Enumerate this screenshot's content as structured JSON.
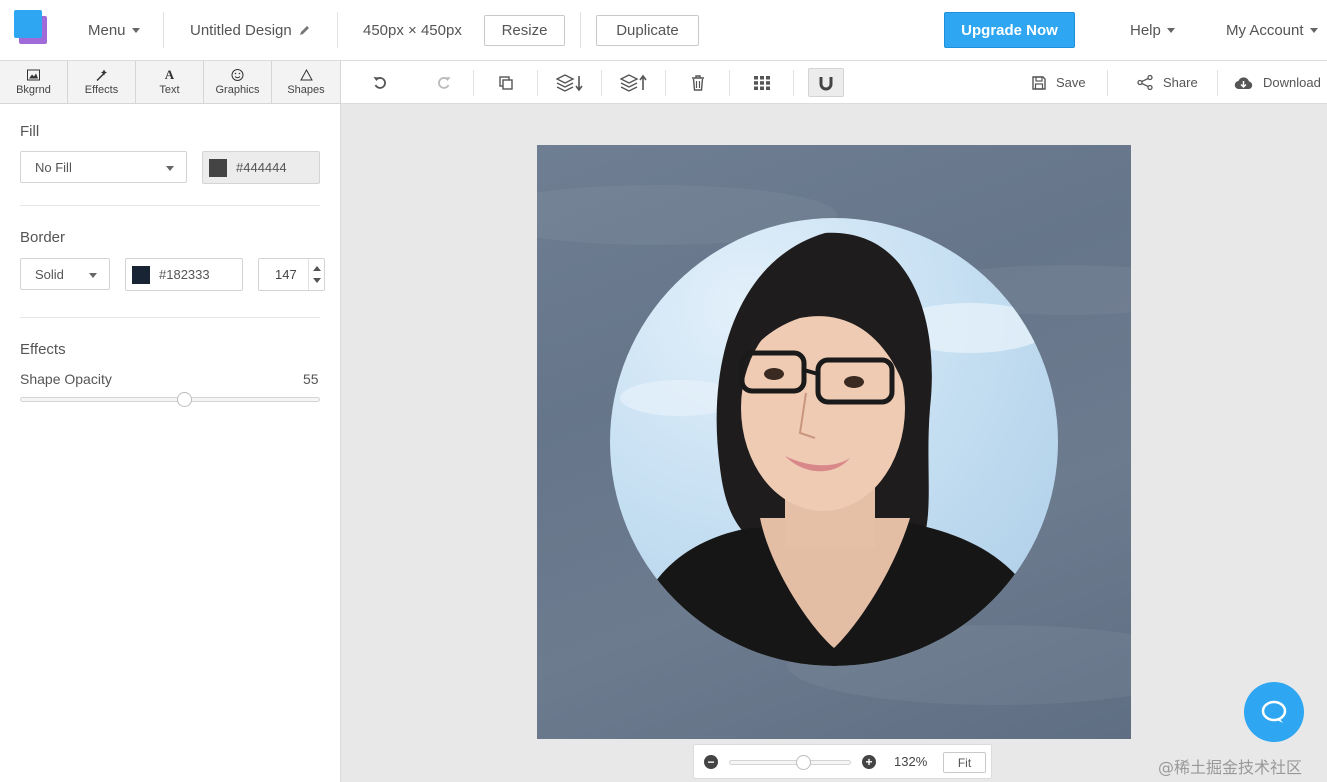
{
  "topbar": {
    "menu_label": "Menu",
    "design_title": "Untitled Design",
    "dimensions": "450px × 450px",
    "resize_label": "Resize",
    "duplicate_label": "Duplicate",
    "upgrade_label": "Upgrade Now",
    "help_label": "Help",
    "account_label": "My Account"
  },
  "tabs": [
    {
      "label": "Bkgrnd",
      "icon": "image-icon"
    },
    {
      "label": "Effects",
      "icon": "magic-wand-icon"
    },
    {
      "label": "Text",
      "icon": "text-icon"
    },
    {
      "label": "Graphics",
      "icon": "smiley-icon"
    },
    {
      "label": "Shapes",
      "icon": "triangle-icon"
    }
  ],
  "toolbar": {
    "save_label": "Save",
    "share_label": "Share",
    "download_label": "Download"
  },
  "panel": {
    "fill_title": "Fill",
    "fill_select": "No Fill",
    "fill_color_hex": "#444444",
    "border_title": "Border",
    "border_style": "Solid",
    "border_color_hex": "#182333",
    "border_width": "147",
    "effects_title": "Effects",
    "opacity_label": "Shape Opacity",
    "opacity_value": "55"
  },
  "zoom": {
    "percent": "132%",
    "fit_label": "Fit",
    "minus": "−",
    "plus": "+"
  },
  "watermark": "@稀土掘金技术社区",
  "colors": {
    "accent": "#2ea6f1",
    "fill_swatch": "#444444",
    "border_swatch": "#182333",
    "canvas_bg": "#6b7a8e"
  }
}
